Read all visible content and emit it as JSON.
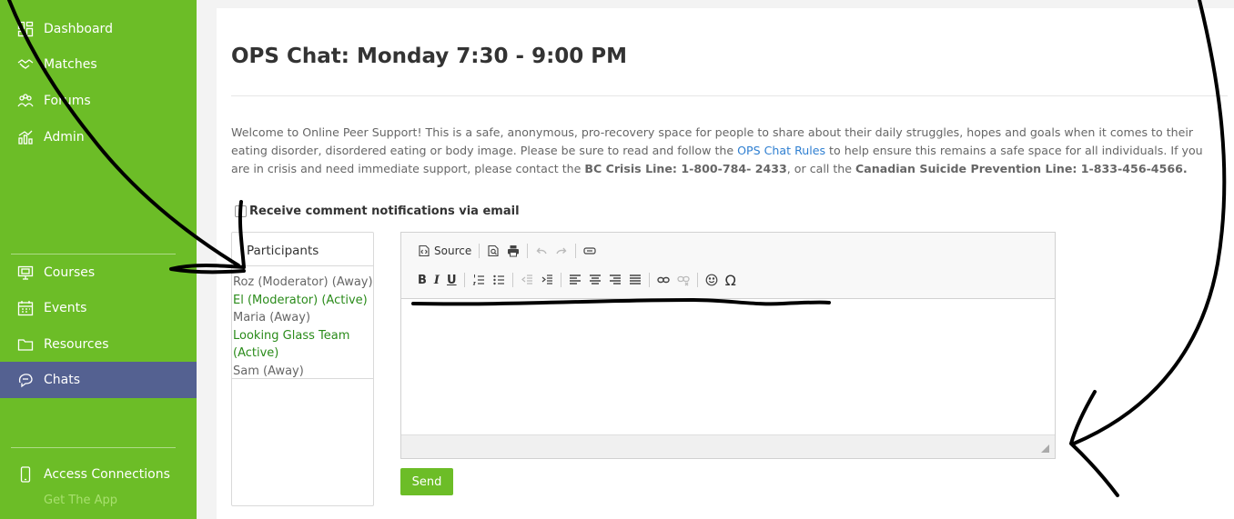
{
  "sidebar": {
    "items": [
      {
        "label": "Dashboard",
        "icon": "dashboard-icon"
      },
      {
        "label": "Matches",
        "icon": "handshake-icon"
      },
      {
        "label": "Forums",
        "icon": "people-icon"
      },
      {
        "label": "Admin",
        "icon": "chart-icon"
      },
      {
        "label": "Courses",
        "icon": "monitor-icon"
      },
      {
        "label": "Events",
        "icon": "calendar-icon"
      },
      {
        "label": "Resources",
        "icon": "folder-icon"
      },
      {
        "label": "Chats",
        "icon": "chat-icon"
      },
      {
        "label": "Access Connections",
        "icon": "phone-icon"
      }
    ],
    "get_app": "Get The App",
    "active_item": "Chats"
  },
  "page": {
    "title": "OPS Chat: Monday 7:30 - 9:00 PM",
    "intro_part1": "Welcome to Online Peer Support! This is a safe, anonymous, pro-recovery space for people to share about their daily struggles, hopes and goals when it comes to their eating disorder, disordered eating or body image. Please be sure to read and follow the ",
    "intro_link": "OPS Chat Rules",
    "intro_part2": " to help ensure this remains a safe space for all individuals. If you are in crisis and need immediate support, please contact the ",
    "crisis_line": "BC Crisis Line: 1-800-784- 2433",
    "intro_part3": ", or call the ",
    "suicide_line": "Canadian Suicide Prevention Line: 1-833-456-4566.",
    "notifications_label": "Receive comment notifications via email"
  },
  "participants": {
    "header": "Participants",
    "list": [
      {
        "name": "Roz (Moderator) (Away)",
        "status": "away"
      },
      {
        "name": "El (Moderator) (Active)",
        "status": "active"
      },
      {
        "name": "Maria (Away)",
        "status": "away"
      },
      {
        "name": "Looking Glass Team (Active)",
        "status": "active"
      },
      {
        "name": "Sam (Away)",
        "status": "away"
      }
    ]
  },
  "editor": {
    "source_label": "Source",
    "bold": "B",
    "italic": "I",
    "underline": "U",
    "omega": "Ω"
  },
  "send_label": "Send",
  "colors": {
    "sidebar_green": "#6cbd27",
    "active_nav": "#546191",
    "link_blue": "#2f7fd1",
    "active_participant": "#2a8b1a"
  }
}
